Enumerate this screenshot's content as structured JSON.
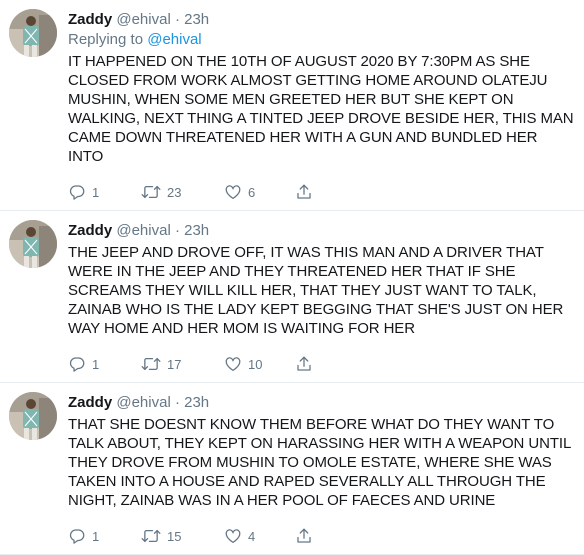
{
  "tweets": [
    {
      "name": "Zaddy",
      "handle": "@ehival",
      "dot": "·",
      "time": "23h",
      "replying_prefix": "Replying to ",
      "replying_mention": "@ehival",
      "text": "IT HAPPENED ON THE 10TH OF AUGUST 2020 BY 7:30PM AS SHE CLOSED FROM WORK ALMOST GETTING HOME AROUND OLATEJU MUSHIN, WHEN SOME MEN GREETED HER BUT  SHE KEPT ON WALKING, NEXT THING A TINTED JEEP DROVE BESIDE HER, THIS MAN CAME DOWN THREATENED HER WITH A GUN AND BUNDLED HER INTO",
      "replies": "1",
      "retweets": "23",
      "likes": "6"
    },
    {
      "name": "Zaddy",
      "handle": "@ehival",
      "dot": "·",
      "time": "23h",
      "text": "THE JEEP AND DROVE OFF, IT WAS THIS MAN AND A DRIVER THAT WERE IN THE JEEP AND THEY THREATENED HER THAT IF SHE SCREAMS THEY WILL KILL HER, THAT THEY JUST WANT TO TALK, ZAINAB WHO IS THE LADY KEPT BEGGING THAT SHE'S JUST ON HER WAY HOME AND HER MOM IS WAITING FOR HER",
      "replies": "1",
      "retweets": "17",
      "likes": "10"
    },
    {
      "name": "Zaddy",
      "handle": "@ehival",
      "dot": "·",
      "time": "23h",
      "text": "THAT SHE DOESNT KNOW THEM BEFORE WHAT DO THEY WANT TO TALK ABOUT, THEY KEPT ON HARASSING HER WITH A WEAPON UNTIL THEY DROVE FROM MUSHIN TO OMOLE ESTATE, WHERE SHE WAS TAKEN INTO A HOUSE AND RAPED SEVERALLY ALL THROUGH THE NIGHT, ZAINAB WAS IN A HER POOL OF FAECES AND URINE",
      "replies": "1",
      "retweets": "15",
      "likes": "4"
    }
  ],
  "icons": {
    "reply": "reply-icon",
    "retweet": "retweet-icon",
    "like": "heart-icon",
    "share": "share-icon"
  },
  "colors": {
    "text": "#14171a",
    "secondary": "#657786",
    "link": "#1b95e0",
    "divider": "#e6ecf0"
  }
}
